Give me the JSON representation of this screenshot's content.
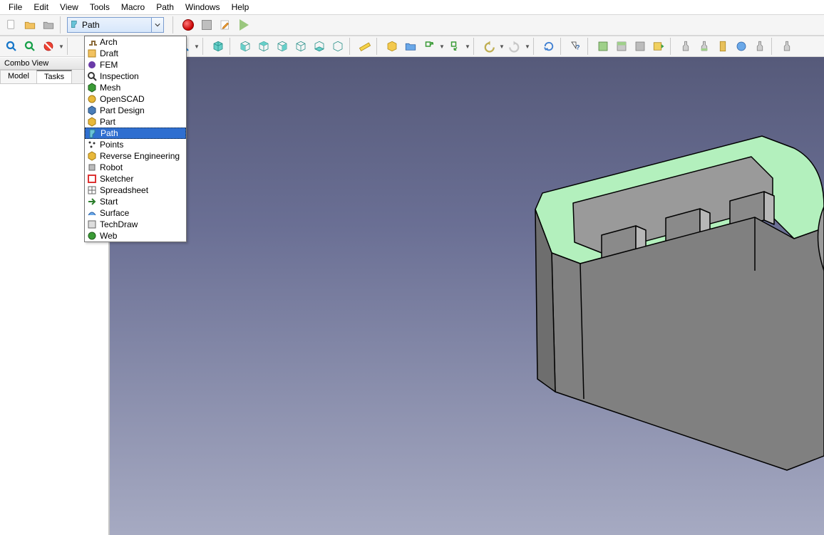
{
  "menu": {
    "items": [
      "File",
      "Edit",
      "View",
      "Tools",
      "Macro",
      "Path",
      "Windows",
      "Help"
    ]
  },
  "combo": {
    "selected": "Path"
  },
  "workbenches": [
    {
      "label": "Arch",
      "icon": "arch"
    },
    {
      "label": "Draft",
      "icon": "draft"
    },
    {
      "label": "FEM",
      "icon": "fem"
    },
    {
      "label": "Inspection",
      "icon": "inspection"
    },
    {
      "label": "Mesh",
      "icon": "mesh"
    },
    {
      "label": "OpenSCAD",
      "icon": "openscad"
    },
    {
      "label": "Part Design",
      "icon": "partdesign"
    },
    {
      "label": "Part",
      "icon": "part"
    },
    {
      "label": "Path",
      "icon": "path",
      "selected": true
    },
    {
      "label": "Points",
      "icon": "points"
    },
    {
      "label": "Reverse Engineering",
      "icon": "reveng"
    },
    {
      "label": "Robot",
      "icon": "robot"
    },
    {
      "label": "Sketcher",
      "icon": "sketcher"
    },
    {
      "label": "Spreadsheet",
      "icon": "spreadsheet"
    },
    {
      "label": "Start",
      "icon": "start"
    },
    {
      "label": "Surface",
      "icon": "surface"
    },
    {
      "label": "TechDraw",
      "icon": "techdraw"
    },
    {
      "label": "Web",
      "icon": "web"
    }
  ],
  "panel": {
    "title": "Combo View",
    "tabs": [
      "Model",
      "Tasks"
    ],
    "active_tab": 1
  },
  "colors": {
    "accent": "#2f6fd0",
    "viewport_top": "#565a7a",
    "viewport_bottom": "#a6aac2",
    "model_body": "#808080",
    "model_top": "#afe9b8"
  }
}
